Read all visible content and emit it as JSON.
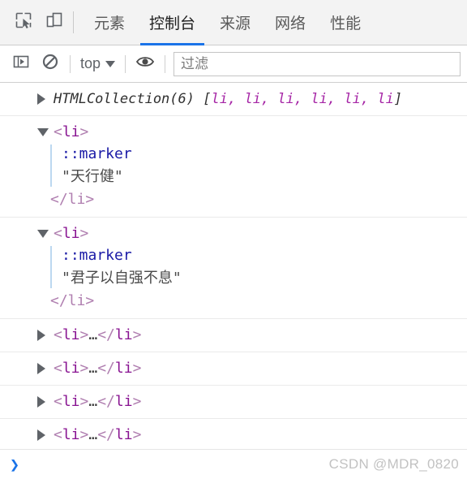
{
  "toolbar": {
    "inspect_icon": "inspect-element-icon",
    "device_icon": "device-toolbar-icon",
    "tabs": [
      {
        "label": "元素",
        "name": "tab-elements",
        "active": false
      },
      {
        "label": "控制台",
        "name": "tab-console",
        "active": true
      },
      {
        "label": "来源",
        "name": "tab-sources",
        "active": false
      },
      {
        "label": "网络",
        "name": "tab-network",
        "active": false
      },
      {
        "label": "性能",
        "name": "tab-performance",
        "active": false
      }
    ],
    "active_tab": "控制台",
    "accent_color": "#1a73e8"
  },
  "filterbar": {
    "sidebar_icon": "console-sidebar-icon",
    "clear_icon": "clear-console-icon",
    "context_value": "top",
    "eye_icon": "live-expression-eye-icon",
    "filter_placeholder": "过滤",
    "filter_value": ""
  },
  "console": {
    "collection": {
      "prefix": "HTMLCollection(6)",
      "bracket_open": " [",
      "items": [
        "li,",
        "li,",
        "li,",
        "li,",
        "li,",
        "li"
      ],
      "bracket_close": "]",
      "expanded": false
    },
    "expanded_nodes": [
      {
        "open_tag_open": "<",
        "tag": "li",
        "open_tag_close": ">",
        "marker": "::marker",
        "text": "\"天行健\"",
        "close_tag": "</li>",
        "expanded": true
      },
      {
        "open_tag_open": "<",
        "tag": "li",
        "open_tag_close": ">",
        "marker": "::marker",
        "text": "\"君子以自强不息\"",
        "close_tag": "</li>",
        "expanded": true
      }
    ],
    "collapsed_nodes": [
      {
        "open": "<",
        "tag": "li",
        "gt": ">",
        "ellipsis": "…",
        "close_open": "</",
        "close_tag": "li",
        "close_gt": ">"
      },
      {
        "open": "<",
        "tag": "li",
        "gt": ">",
        "ellipsis": "…",
        "close_open": "</",
        "close_tag": "li",
        "close_gt": ">"
      },
      {
        "open": "<",
        "tag": "li",
        "gt": ">",
        "ellipsis": "…",
        "close_open": "</",
        "close_tag": "li",
        "close_gt": ">"
      },
      {
        "open": "<",
        "tag": "li",
        "gt": ">",
        "ellipsis": "…",
        "close_open": "</",
        "close_tag": "li",
        "close_gt": ">"
      }
    ]
  },
  "prompt": {
    "chevron": "❯",
    "input_value": ""
  },
  "watermark": {
    "text": "CSDN @MDR_0820"
  },
  "colors": {
    "tagname": "#881391",
    "angle": "#b07fb0",
    "marker": "#1a1aa6",
    "collection_item": "#a626a6",
    "guide_line": "#bcd8f0"
  }
}
